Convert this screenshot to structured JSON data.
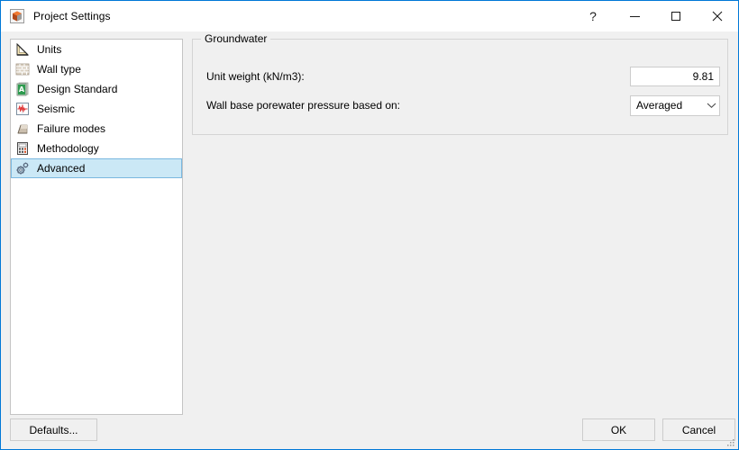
{
  "window": {
    "title": "Project Settings",
    "icon": "app-cube-icon",
    "border_color": "#0078d7",
    "titlebar_background": "#ffffff",
    "client_background": "#f0f0f0"
  },
  "caption_buttons": [
    {
      "name": "help-button",
      "glyph": "?"
    },
    {
      "name": "minimize-button",
      "glyph": "—"
    },
    {
      "name": "maximize-button",
      "glyph": "□"
    },
    {
      "name": "close-button",
      "glyph": "✕"
    }
  ],
  "sidebar": {
    "selected_index": 6,
    "selection_color": "#cbe8f6",
    "items": [
      {
        "label": "Units",
        "icon": "set-square-ruler-icon"
      },
      {
        "label": "Wall type",
        "icon": "brick-wall-icon"
      },
      {
        "label": "Design Standard",
        "icon": "green-document-icon"
      },
      {
        "label": "Seismic",
        "icon": "seismic-waveform-icon"
      },
      {
        "label": "Failure modes",
        "icon": "slope-wedge-icon"
      },
      {
        "label": "Methodology",
        "icon": "calculator-icon"
      },
      {
        "label": "Advanced",
        "icon": "gears-icon"
      }
    ]
  },
  "content": {
    "group": {
      "title": "Groundwater",
      "fields": [
        {
          "label": "Unit weight (kN/m3):",
          "control": "text-input",
          "value": "9.81",
          "placeholder": ""
        },
        {
          "label": "Wall base porewater pressure based on:",
          "control": "combo-box",
          "value": "Averaged"
        }
      ]
    }
  },
  "footer": {
    "defaults_label": "Defaults...",
    "ok_label": "OK",
    "cancel_label": "Cancel"
  }
}
